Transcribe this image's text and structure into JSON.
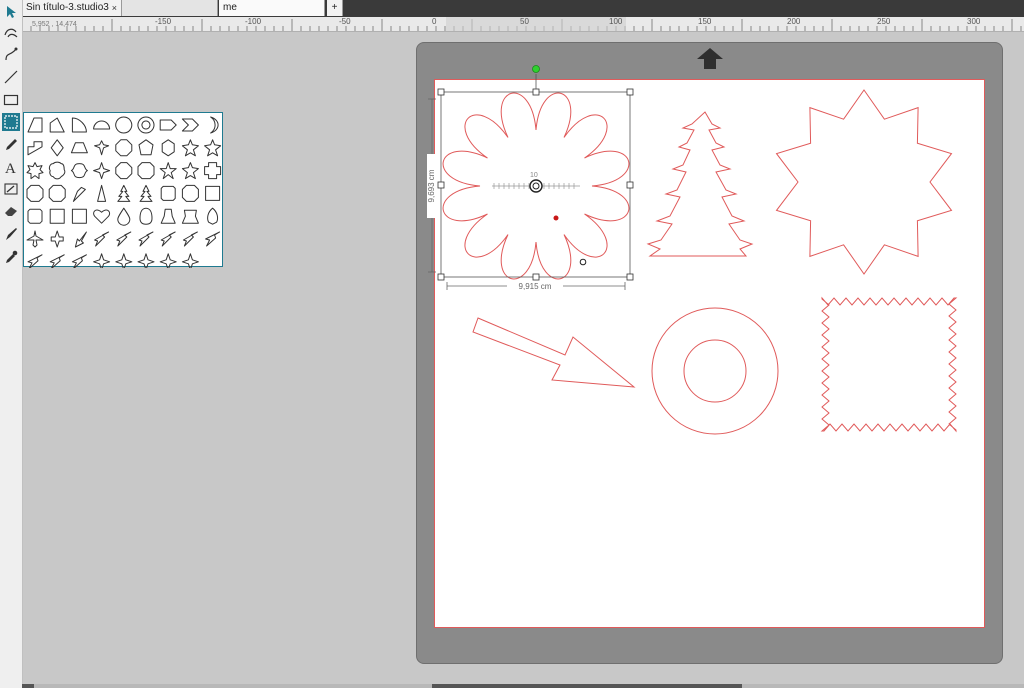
{
  "tabs": {
    "tab1": "Sin título-3.studio3",
    "tab1_close": "×",
    "tab3": "me",
    "add": "+"
  },
  "ruler": {
    "labels": [
      "-150",
      "-100",
      "-50",
      "0",
      "50",
      "100",
      "150",
      "200",
      "250",
      "300"
    ]
  },
  "status": {
    "coordinates": "5,952 , 14,474"
  },
  "selection": {
    "width_label": "9,915 cm",
    "height_label": "9,693 cm",
    "center_value": "10"
  },
  "colors": {
    "accent": "#1f7a90",
    "cut_line": "#e05a5a",
    "mat": "#8a8a8a",
    "rotate_handle": "#2fd12f"
  },
  "icons": {
    "toolbar": [
      "pointer-icon",
      "edit-points-icon",
      "curve-icon",
      "line-icon",
      "rectangle-icon",
      "shape-library-icon",
      "pencil-icon",
      "text-icon",
      "text-box-icon",
      "eraser-icon",
      "knife-icon",
      "eyedropper-icon"
    ],
    "shape_grid": "simple shapes palette"
  }
}
